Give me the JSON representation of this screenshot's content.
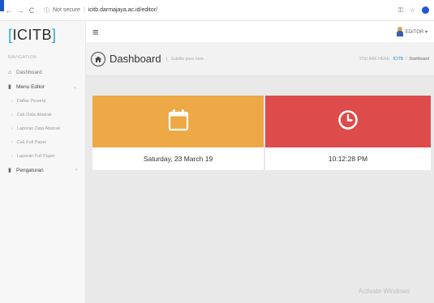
{
  "browser": {
    "nav_back": "←",
    "nav_forward": "→",
    "nav_reload": "C",
    "security_label": "Not secure",
    "url": "icitb.darmajaya.ac.id/editor/"
  },
  "sidebar": {
    "logo_text": "ICITB",
    "nav_heading": "NAVIGATION",
    "items": [
      {
        "label": "Dashboard"
      },
      {
        "label": "Menu Editor"
      },
      {
        "label": "Pengaturan"
      }
    ],
    "sub_items": [
      {
        "label": "Daftar Peserta"
      },
      {
        "label": "Cek Data Abstrak"
      },
      {
        "label": "Laporan Data Abstrak"
      },
      {
        "label": "Cek Full Paper"
      },
      {
        "label": "Laporan Full Paper"
      }
    ]
  },
  "header": {
    "user_label": "EDITOR ▾"
  },
  "page": {
    "title": "Dashboard",
    "subtitle": "Subtitle goes here...",
    "breadcrumb_prefix": "YOU ARE HERE:",
    "breadcrumb_link": "ICITB",
    "breadcrumb_current": "Dashboard"
  },
  "cards": {
    "date_text": "Saturday, 23 March 19",
    "time_text": "10:12:28 PM",
    "date_color": "#eda945",
    "time_color": "#dd4b4a"
  },
  "watermark": "Activate Windows"
}
